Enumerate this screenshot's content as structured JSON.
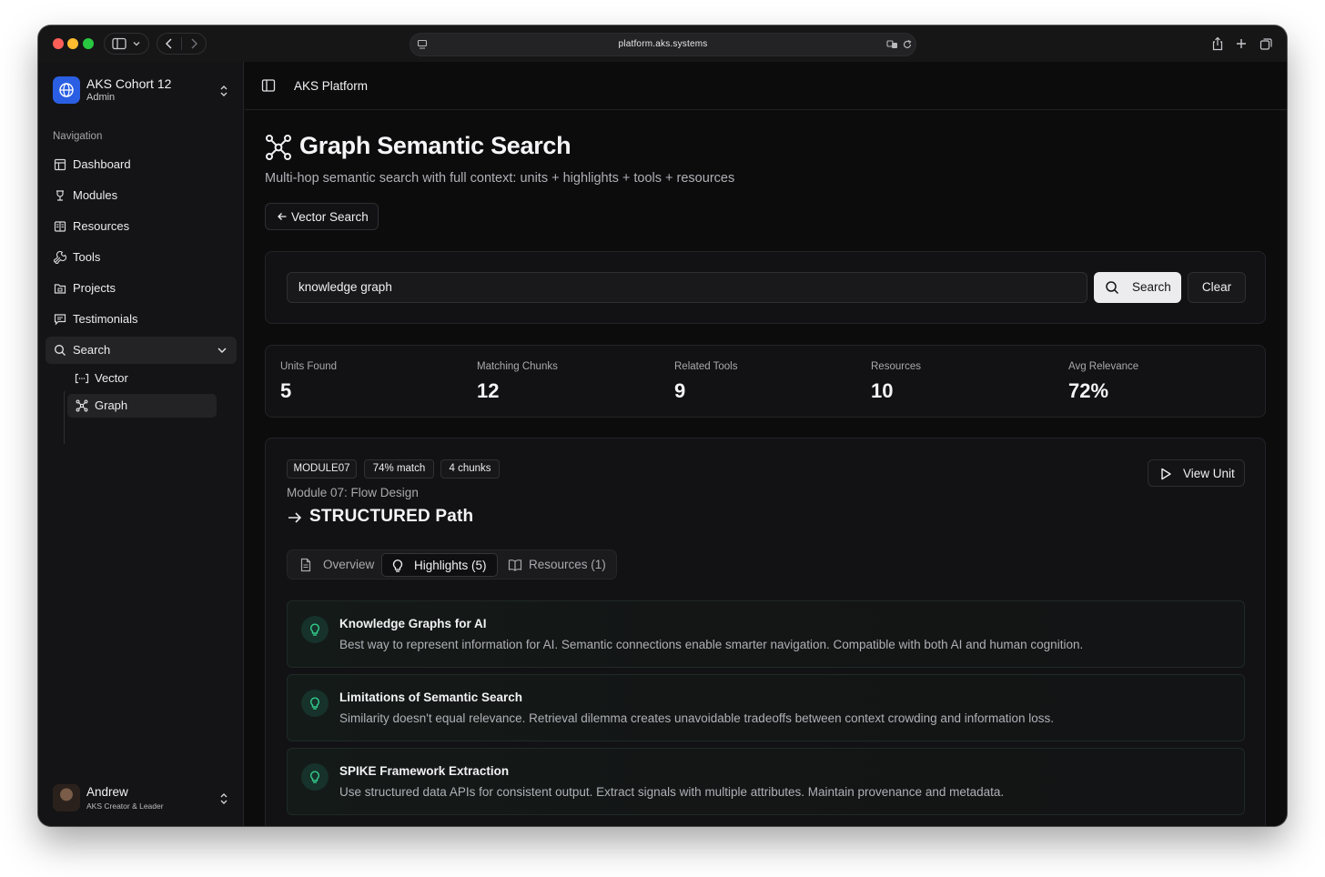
{
  "browser": {
    "url": "platform.aks.systems"
  },
  "org": {
    "name": "AKS Cohort 12",
    "role": "Admin"
  },
  "sidebar": {
    "section_title": "Navigation",
    "items": [
      {
        "label": "Dashboard",
        "icon": "dashboard-icon"
      },
      {
        "label": "Modules",
        "icon": "modules-icon"
      },
      {
        "label": "Resources",
        "icon": "resources-icon"
      },
      {
        "label": "Tools",
        "icon": "tools-icon"
      },
      {
        "label": "Projects",
        "icon": "projects-icon"
      },
      {
        "label": "Testimonials",
        "icon": "testimonials-icon"
      },
      {
        "label": "Search",
        "icon": "search-icon"
      }
    ],
    "sub_items": [
      {
        "label": "Vector",
        "icon": "vector-icon"
      },
      {
        "label": "Graph",
        "icon": "graph-icon"
      }
    ]
  },
  "user": {
    "name": "Andrew",
    "role": "AKS Creator & Leader"
  },
  "topbar": {
    "breadcrumb": "AKS Platform"
  },
  "page": {
    "title": "Graph Semantic Search",
    "subtitle": "Multi-hop semantic search with full context: units + highlights + tools + resources",
    "back_button": "Vector Search"
  },
  "search": {
    "value": "knowledge graph",
    "search_label": "Search",
    "clear_label": "Clear"
  },
  "stats": [
    {
      "label": "Units Found",
      "value": "5"
    },
    {
      "label": "Matching Chunks",
      "value": "12"
    },
    {
      "label": "Related Tools",
      "value": "9"
    },
    {
      "label": "Resources",
      "value": "10"
    },
    {
      "label": "Avg Relevance",
      "value": "72%"
    }
  ],
  "result": {
    "badges": [
      "MODULE07",
      "74% match",
      "4 chunks"
    ],
    "module": "Module 07: Flow Design",
    "title": "STRUCTURED Path",
    "view_label": "View Unit",
    "tabs": [
      {
        "label": "Overview",
        "icon": "document-icon"
      },
      {
        "label": "Highlights (5)",
        "icon": "lightbulb-icon"
      },
      {
        "label": "Resources (1)",
        "icon": "book-icon"
      }
    ],
    "active_tab": "Highlights (5)",
    "highlights": [
      {
        "title": "Knowledge Graphs for AI",
        "body": "Best way to represent information for AI. Semantic connections enable smarter navigation. Compatible with both AI and human cognition."
      },
      {
        "title": "Limitations of Semantic Search",
        "body": "Similarity doesn't equal relevance. Retrieval dilemma creates unavoidable tradeoffs between context crowding and information loss."
      },
      {
        "title": "SPIKE Framework Extraction",
        "body": "Use structured data APIs for consistent output. Extract signals with multiple attributes. Maintain provenance and metadata."
      }
    ]
  },
  "colors": {
    "accent_green": "#34c98b",
    "org_blue": "#2b5fe3"
  }
}
